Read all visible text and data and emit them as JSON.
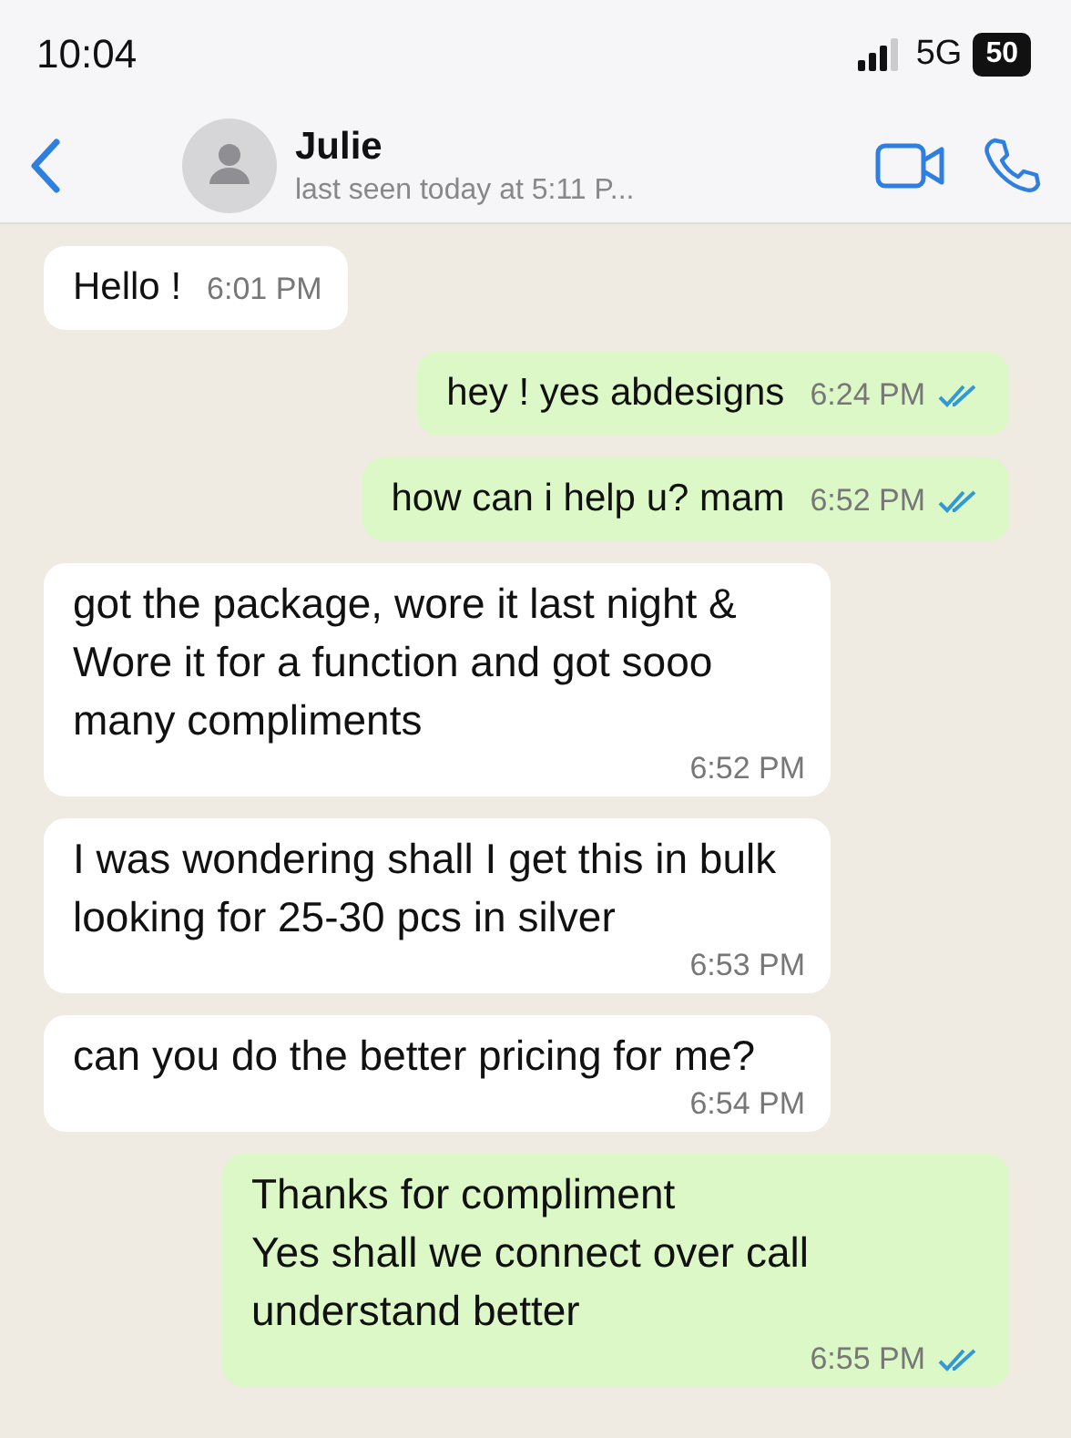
{
  "status_bar": {
    "time": "10:04",
    "network": "5G",
    "battery": "50"
  },
  "header": {
    "name": "Julie",
    "status": "last seen today at 5:11 P..."
  },
  "messages": [
    {
      "outgoing": false,
      "time_below": false,
      "paragraphs": [
        "Hello !"
      ],
      "time": "6:01 PM"
    },
    {
      "outgoing": true,
      "time_below": false,
      "paragraphs": [
        "hey ! yes abdesigns"
      ],
      "time": "6:24 PM",
      "read": true
    },
    {
      "outgoing": true,
      "time_below": false,
      "paragraphs": [
        "how can i help u? mam"
      ],
      "time": "6:52 PM",
      "read": true
    },
    {
      "outgoing": false,
      "time_below": true,
      "paragraphs": [
        "got the package, wore it last night &",
        "Wore it for a function and got sooo many compliments"
      ],
      "time": "6:52 PM"
    },
    {
      "outgoing": false,
      "time_below": true,
      "paragraphs": [
        "I was wondering shall I get this in bulk looking for 25-30 pcs in silver"
      ],
      "time": "6:53 PM"
    },
    {
      "outgoing": false,
      "time_below": true,
      "paragraphs": [
        "can you do the better pricing for me?"
      ],
      "time": "6:54 PM"
    },
    {
      "outgoing": true,
      "time_below": true,
      "paragraphs": [
        "Thanks for compliment",
        "Yes shall we connect over call understand better"
      ],
      "time": "6:55 PM",
      "read": true
    }
  ]
}
